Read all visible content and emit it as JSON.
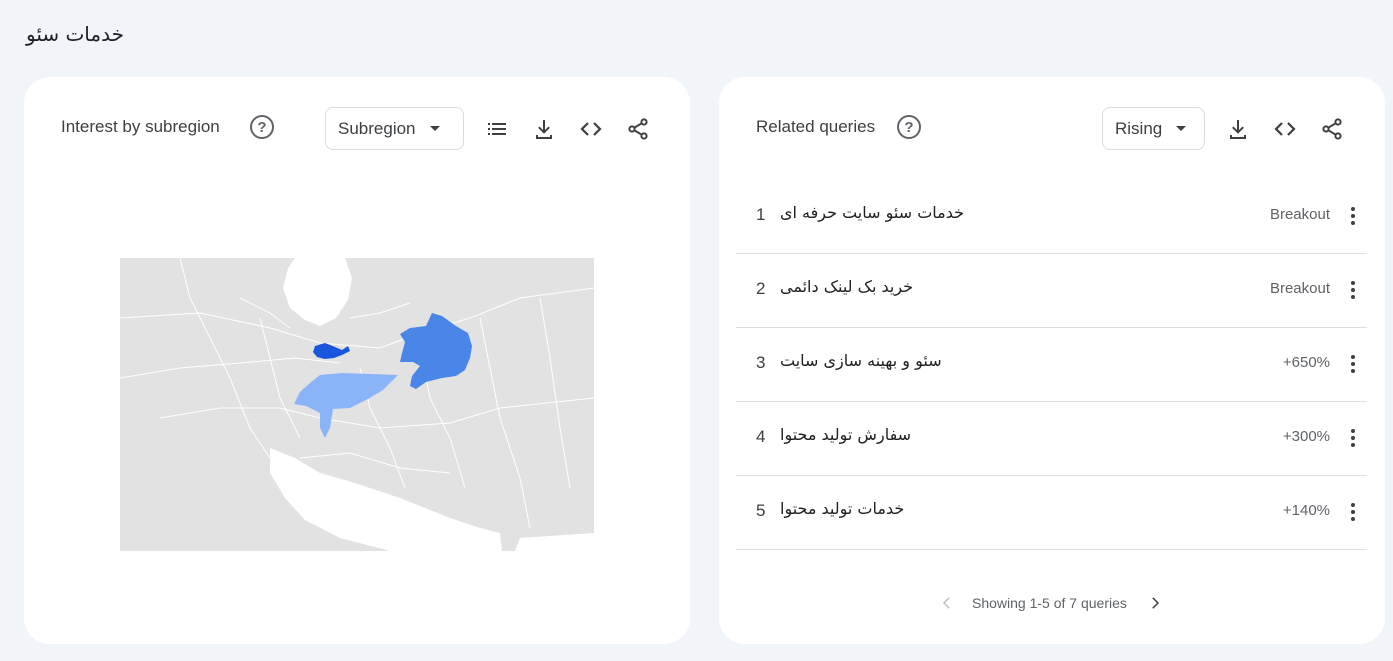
{
  "page": {
    "title": "خدمات سئو"
  },
  "interest_by_subregion": {
    "title": "Interest by subregion",
    "help_icon": "help-circle-icon",
    "dropdown_value": "Subregion",
    "icons": [
      "list-icon",
      "download-icon",
      "embed-icon",
      "share-icon"
    ],
    "map_colors": {
      "background": "#e2e2e2",
      "high": "#1a56db",
      "medium": "#4a86e8",
      "low": "#8ab4f8"
    }
  },
  "related_queries": {
    "title": "Related queries",
    "help_icon": "help-circle-icon",
    "dropdown_value": "Rising",
    "icons": [
      "download-icon",
      "embed-icon",
      "share-icon"
    ],
    "items": [
      {
        "rank": "1",
        "query": "خدمات سئو سایت حرفه ای",
        "value": "Breakout"
      },
      {
        "rank": "2",
        "query": "خرید بک لینک دائمی",
        "value": "Breakout"
      },
      {
        "rank": "3",
        "query": "سئو و بهینه سازی سایت",
        "value": "+650%"
      },
      {
        "rank": "4",
        "query": "سفارش تولید محتوا",
        "value": "+300%"
      },
      {
        "rank": "5",
        "query": "خدمات تولید محتوا",
        "value": "+140%"
      }
    ],
    "pagination": "Showing 1-5 of 7 queries"
  }
}
